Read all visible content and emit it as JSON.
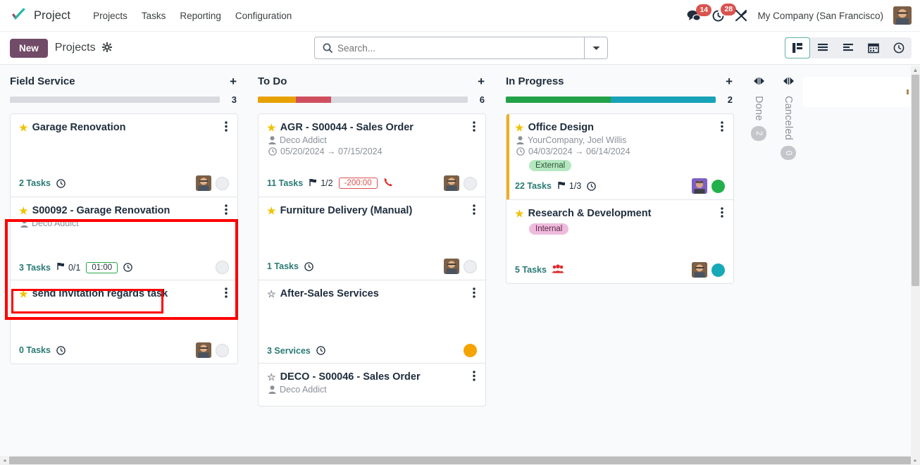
{
  "navbar": {
    "brand": "Project",
    "logo_icon": "odoo-check-logo",
    "menus": [
      "Projects",
      "Tasks",
      "Reporting",
      "Configuration"
    ],
    "messages_icon": "chat-bubble-icon",
    "messages_count": "14",
    "activities_icon": "clock-activity-icon",
    "activities_count": "28",
    "debug_icon": "bug-tools-icon",
    "company": "My Company (San Francisco)",
    "avatar_icon": "user-avatar"
  },
  "control_panel": {
    "new_label": "New",
    "breadcrumb": "Projects",
    "gear_icon": "gear-icon",
    "search": {
      "icon": "search-icon",
      "value": "",
      "placeholder": "Search...",
      "toggle_icon": "chevron-down-icon"
    },
    "views": [
      {
        "name": "kanban",
        "icon": "kanban-icon",
        "active": true
      },
      {
        "name": "list",
        "icon": "list-icon",
        "active": false
      },
      {
        "name": "activity",
        "icon": "activity-icon",
        "active": false
      },
      {
        "name": "calendar",
        "icon": "calendar-icon",
        "active": false
      },
      {
        "name": "timesheet",
        "icon": "clock-icon",
        "active": false
      }
    ]
  },
  "columns": [
    {
      "title": "Field Service",
      "count": "3",
      "add_icon": "plus-icon",
      "progress": [
        {
          "color": "#d7dade",
          "pct": 100
        }
      ],
      "cards": [
        {
          "title": "Garage Renovation",
          "starred": true,
          "customer": null,
          "dates": null,
          "tag": null,
          "tasks_label": "2 Tasks",
          "flag": null,
          "hours": null,
          "clock": true,
          "phone": false,
          "people": false,
          "avatar": "user-avatar",
          "dot": "gray",
          "stripe": false,
          "highlight": false
        },
        {
          "title": "S00092 - Garage Renovation",
          "starred": true,
          "customer": "Deco Addict",
          "dates": null,
          "tag": null,
          "tasks_label": "3 Tasks",
          "flag": "0/1",
          "hours": "01:00",
          "hours_state": "positive",
          "clock": true,
          "phone": false,
          "people": false,
          "avatar": null,
          "dot": "gray",
          "stripe": false,
          "highlight": true
        },
        {
          "title": "send Invitation regards task",
          "starred": true,
          "customer": null,
          "dates": null,
          "tag": null,
          "tasks_label": "0 Tasks",
          "flag": null,
          "hours": null,
          "clock": true,
          "phone": false,
          "people": false,
          "avatar": "user-avatar",
          "dot": "gray",
          "stripe": false,
          "highlight": false
        }
      ]
    },
    {
      "title": "To Do",
      "count": "6",
      "add_icon": "plus-icon",
      "progress": [
        {
          "color": "#e8a200",
          "pct": 18
        },
        {
          "color": "#d04f5f",
          "pct": 17
        },
        {
          "color": "#d7dade",
          "pct": 65
        }
      ],
      "cards": [
        {
          "title": "AGR - S00044 - Sales Order",
          "starred": true,
          "customer": "Deco Addict",
          "dates": "05/20/2024  →  07/15/2024",
          "tag": null,
          "tasks_label": "11 Tasks",
          "flag": "1/2",
          "hours": "-200:00",
          "hours_state": "negative",
          "clock": false,
          "phone": true,
          "people": false,
          "avatar": "user-avatar",
          "dot": "gray",
          "stripe": false,
          "highlight": false
        },
        {
          "title": "Furniture Delivery (Manual)",
          "starred": true,
          "customer": null,
          "dates": null,
          "tag": null,
          "tasks_label": "1 Tasks",
          "flag": null,
          "hours": null,
          "clock": true,
          "phone": false,
          "people": false,
          "avatar": "user-avatar",
          "dot": "gray",
          "stripe": false,
          "highlight": false
        },
        {
          "title": "After-Sales Services",
          "starred": false,
          "customer": null,
          "dates": null,
          "tag": null,
          "tasks_label": "3 Services",
          "flag": null,
          "hours": null,
          "clock": true,
          "phone": false,
          "people": false,
          "avatar": null,
          "dot": "orange",
          "stripe": false,
          "highlight": false
        },
        {
          "title": "DECO - S00046 - Sales Order",
          "starred": false,
          "customer": "Deco Addict",
          "dates": null,
          "tag": null,
          "tasks_label": null,
          "flag": null,
          "hours": null,
          "clock": false,
          "phone": false,
          "people": false,
          "avatar": null,
          "dot": null,
          "stripe": false,
          "highlight": false
        }
      ]
    },
    {
      "title": "In Progress",
      "count": "2",
      "add_icon": "plus-icon",
      "progress": [
        {
          "color": "#22a148",
          "pct": 50
        },
        {
          "color": "#17a2b8",
          "pct": 50
        }
      ],
      "cards": [
        {
          "title": "Office Design",
          "starred": true,
          "customer": "YourCompany, Joel Willis",
          "dates": "04/03/2024  →  06/14/2024",
          "tag": {
            "label": "External",
            "style": "green"
          },
          "tasks_label": "22 Tasks",
          "flag": "1/3",
          "hours": null,
          "clock": true,
          "phone": false,
          "people": false,
          "avatar": "user-avatar-purple",
          "dot": "green",
          "stripe": true,
          "highlight": false
        },
        {
          "title": "Research & Development",
          "starred": true,
          "customer": null,
          "dates": null,
          "tag": {
            "label": "Internal",
            "style": "pink"
          },
          "tasks_label": "5 Tasks",
          "flag": null,
          "hours": null,
          "clock": false,
          "phone": false,
          "people": true,
          "avatar": "user-avatar",
          "dot": "teal",
          "stripe": false,
          "highlight": false
        }
      ]
    }
  ],
  "collapsed_columns": [
    {
      "title": "Done",
      "badge": "2",
      "toggle_icon": "expand-column-icon"
    },
    {
      "title": "Canceled",
      "badge": "0",
      "toggle_icon": "expand-column-icon"
    }
  ],
  "colors": {
    "brand_purple": "#714b67",
    "teal_link": "#2a7a74",
    "star_gold": "#f0c300",
    "annotation_red": "#ff0000"
  }
}
